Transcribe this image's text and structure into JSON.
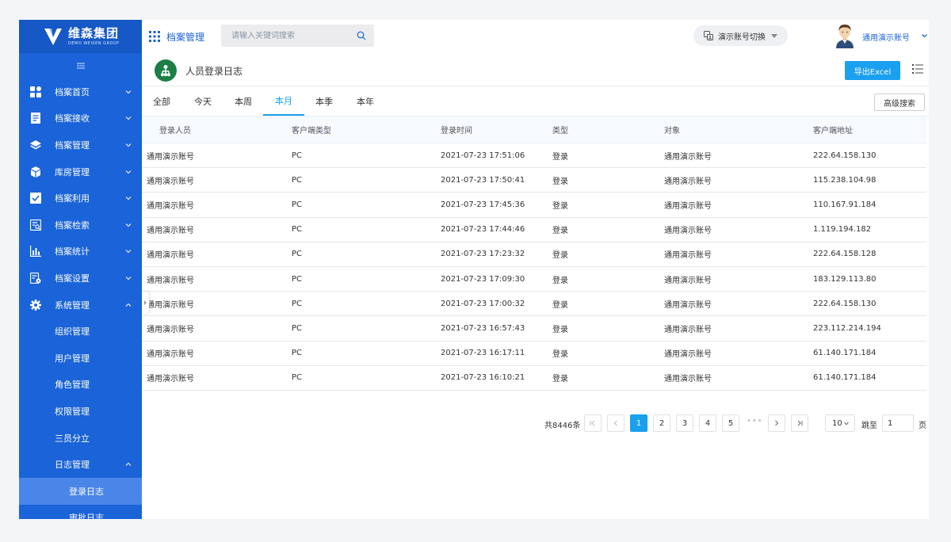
{
  "brand": {
    "name": "维森集团",
    "subtitle": "DEMO WEISEN GROUP"
  },
  "header": {
    "module_title": "档案管理",
    "search_placeholder": "请输入关键词搜索",
    "switch_account": "演示账号切换",
    "user_name": "通用演示账号"
  },
  "sidebar": {
    "items": [
      {
        "label": "档案首页",
        "icon": "dashboard-icon"
      },
      {
        "label": "档案接收",
        "icon": "document-icon"
      },
      {
        "label": "档案管理",
        "icon": "layers-icon"
      },
      {
        "label": "库房管理",
        "icon": "box-icon"
      },
      {
        "label": "档案利用",
        "icon": "checklist-icon"
      },
      {
        "label": "档案检索",
        "icon": "search-doc-icon"
      },
      {
        "label": "档案统计",
        "icon": "bar-chart-icon"
      },
      {
        "label": "档案设置",
        "icon": "settings-doc-icon"
      },
      {
        "label": "系统管理",
        "icon": "gear-icon"
      }
    ],
    "system_children": [
      "组织管理",
      "用户管理",
      "角色管理",
      "权限管理",
      "三员分立"
    ],
    "log_group": "日志管理",
    "log_children": [
      "登录日志",
      "审批日志"
    ]
  },
  "page": {
    "title": "人员登录日志",
    "export_label": "导出Excel",
    "advanced_search": "高级搜索"
  },
  "tabs": [
    "全部",
    "今天",
    "本周",
    "本月",
    "本季",
    "本年"
  ],
  "active_tab": 3,
  "table": {
    "columns": [
      "登录人员",
      "客户端类型",
      "登录时间",
      "类型",
      "对象",
      "客户端地址"
    ],
    "rows": [
      [
        "通用演示账号",
        "PC",
        "2021-07-23 17:51:06",
        "登录",
        "通用演示账号",
        "222.64.158.130"
      ],
      [
        "通用演示账号",
        "PC",
        "2021-07-23 17:50:41",
        "登录",
        "通用演示账号",
        "115.238.104.98"
      ],
      [
        "通用演示账号",
        "PC",
        "2021-07-23 17:45:36",
        "登录",
        "通用演示账号",
        "110.167.91.184"
      ],
      [
        "通用演示账号",
        "PC",
        "2021-07-23 17:44:46",
        "登录",
        "通用演示账号",
        "1.119.194.182"
      ],
      [
        "通用演示账号",
        "PC",
        "2021-07-23 17:23:32",
        "登录",
        "通用演示账号",
        "222.64.158.128"
      ],
      [
        "通用演示账号",
        "PC",
        "2021-07-23 17:09:30",
        "登录",
        "通用演示账号",
        "183.129.113.80"
      ],
      [
        "通用演示账号",
        "PC",
        "2021-07-23 17:00:32",
        "登录",
        "通用演示账号",
        "222.64.158.130"
      ],
      [
        "通用演示账号",
        "PC",
        "2021-07-23 16:57:43",
        "登录",
        "通用演示账号",
        "223.112.214.194"
      ],
      [
        "通用演示账号",
        "PC",
        "2021-07-23 16:17:11",
        "登录",
        "通用演示账号",
        "61.140.171.184"
      ],
      [
        "通用演示账号",
        "PC",
        "2021-07-23 16:10:21",
        "登录",
        "通用演示账号",
        "61.140.171.184"
      ]
    ]
  },
  "pagination": {
    "total": "共8446条",
    "pages": [
      "1",
      "2",
      "3",
      "4",
      "5"
    ],
    "current": "1",
    "ellipsis": "•••",
    "page_size": "10",
    "goto_label": "跳至",
    "goto_value": "1",
    "page_unit": "页"
  },
  "colors": {
    "sidebar": "#1a63d8",
    "accent": "#1aa0ee",
    "page_icon": "#1b7f46"
  }
}
